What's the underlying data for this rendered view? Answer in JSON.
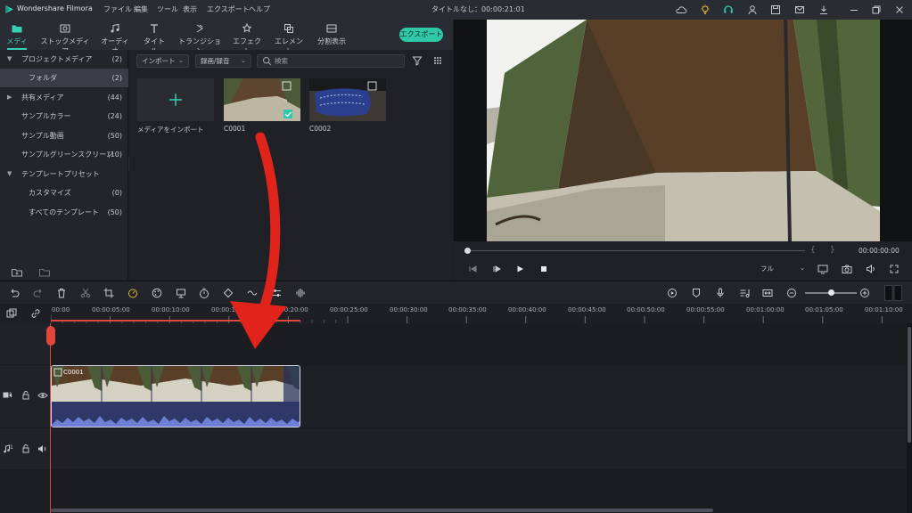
{
  "app": {
    "title": "Wondershare Filmora",
    "menu": [
      "ファイル",
      "編集",
      "ツール",
      "表示",
      "エクスポート",
      "ヘルプ"
    ],
    "project_title": "タイトルなし：00:00:21:01"
  },
  "tabs": [
    "メディア",
    "ストックメディア",
    "オーディオ",
    "タイトル",
    "トランジション",
    "エフェクト",
    "エレメント",
    "分割表示"
  ],
  "export_label": "エクスポート",
  "sidebar": {
    "items": [
      {
        "label": "プロジェクトメディア",
        "count": "(2)"
      },
      {
        "label": "フォルダ",
        "count": "(2)"
      },
      {
        "label": "共有メディア",
        "count": "(44)"
      },
      {
        "label": "サンプルカラー",
        "count": "(24)"
      },
      {
        "label": "サンプル動画",
        "count": "(50)"
      },
      {
        "label": "サンプルグリーンスクリーン",
        "count": "(10)"
      },
      {
        "label": "テンプレートプリセット",
        "count": ""
      },
      {
        "label": "カスタマイズ",
        "count": "(0)"
      },
      {
        "label": "すべてのテンプレート",
        "count": "(50)"
      }
    ]
  },
  "media": {
    "import_dropdown": "インポート",
    "record_dropdown": "録画/録音",
    "search_placeholder": "検索",
    "import_tile_label": "メディアをインポート",
    "clips": [
      "C0001",
      "C0002"
    ]
  },
  "preview": {
    "timecode": "00:00:00:00",
    "quality": "フル"
  },
  "timeline": {
    "ticks": [
      "00:00",
      "00:00:05:00",
      "00:00:10:00",
      "00:00:15:00",
      "00:00:20:00",
      "00:00:25:00",
      "00:00:30:00",
      "00:00:35:00",
      "00:00:40:00",
      "00:00:45:00",
      "00:00:50:00",
      "00:00:55:00",
      "00:01:00:00",
      "00:01:05:00",
      "00:01:10:00"
    ],
    "clip_label": "C0001",
    "video_track": "1",
    "audio_track": "1"
  },
  "colors": {
    "accent": "#2fc9a8",
    "playhead": "#e0473c",
    "arrow": "#e0241b",
    "clip_border": "#cfd4e8"
  }
}
